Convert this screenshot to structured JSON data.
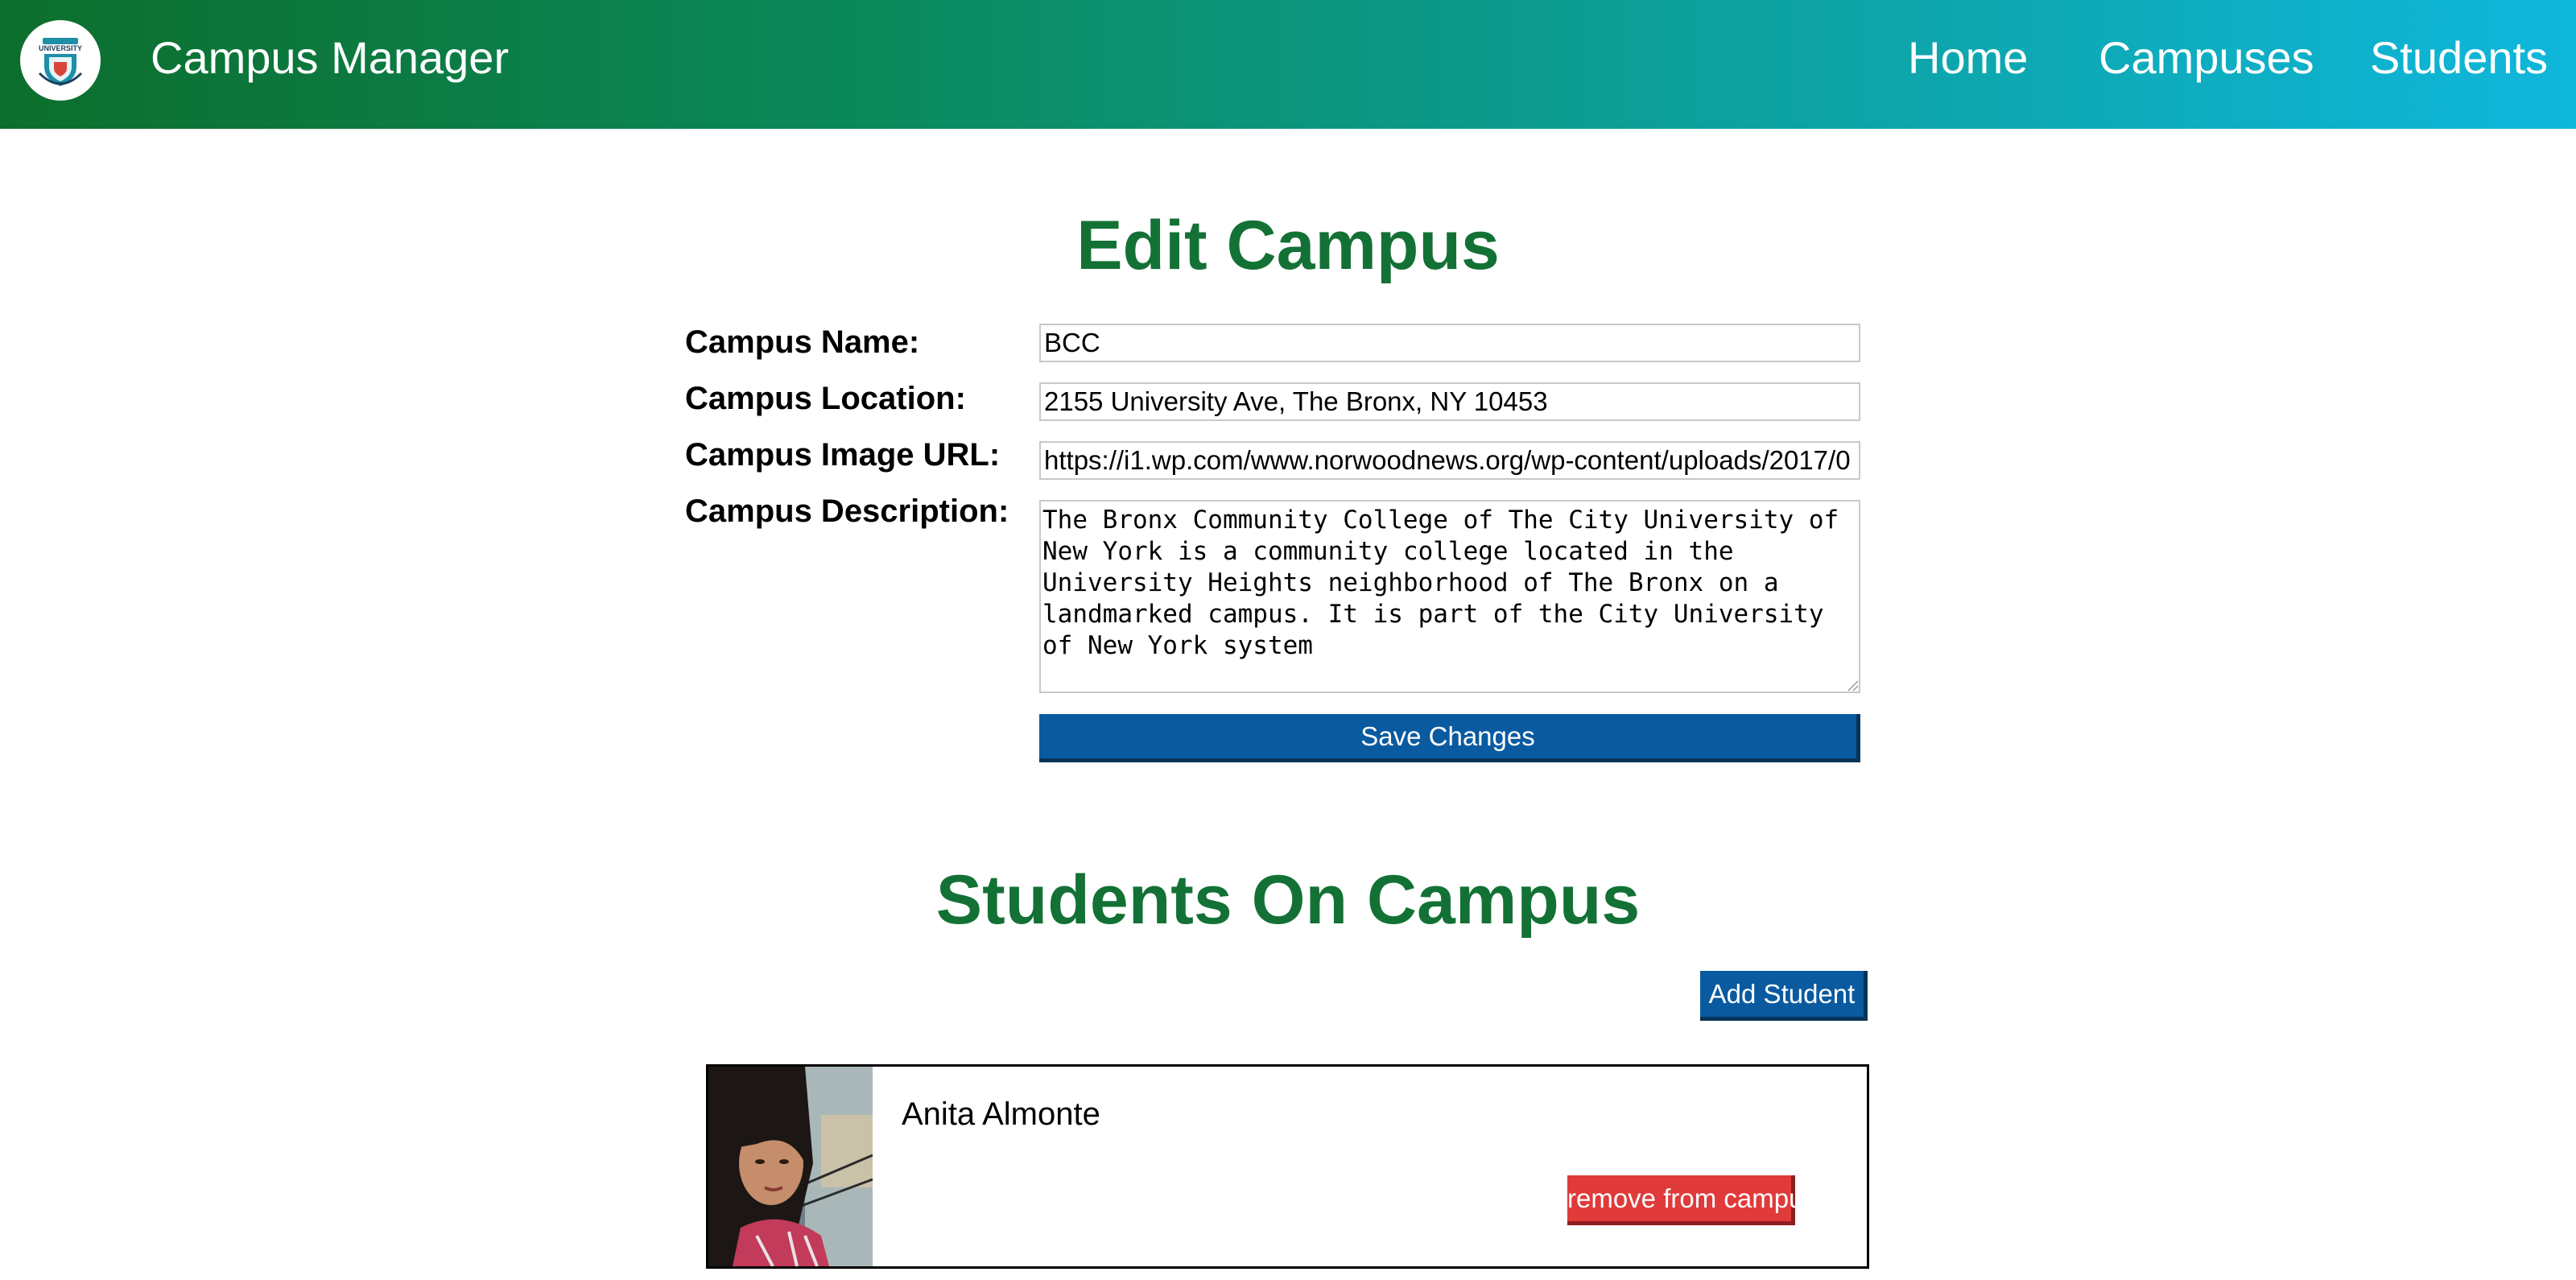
{
  "header": {
    "app_title": "Campus Manager",
    "logo_icon": "university-crest-icon",
    "logo_text": "UNIVERSITY",
    "nav": {
      "home": "Home",
      "campuses": "Campuses",
      "students": "Students"
    },
    "gradient_colors": [
      "#0c6e2c",
      "#0fb7dc"
    ]
  },
  "edit_form": {
    "heading": "Edit Campus",
    "name_label": "Campus Name:",
    "name_value": "BCC",
    "location_label": "Campus Location:",
    "location_value": "2155 University Ave, The Bronx, NY 10453",
    "image_url_label": "Campus Image URL:",
    "image_url_value": "https://i1.wp.com/www.norwoodnews.org/wp-content/uploads/2017/0",
    "description_label": "Campus Description:",
    "description_value": "The Bronx Community College of The City University of New York is a community college located in the University Heights neighborhood of The Bronx on a landmarked campus. It is part of the City University of New York system",
    "save_label": "Save Changes"
  },
  "students_section": {
    "heading": "Students On Campus",
    "add_label": "Add Student",
    "students": [
      {
        "name": "Anita Almonte",
        "remove_label": "remove from campus"
      }
    ]
  },
  "colors": {
    "heading": "#137135",
    "primary_button": "#0a5aa0",
    "danger_button": "#e03a3a"
  }
}
